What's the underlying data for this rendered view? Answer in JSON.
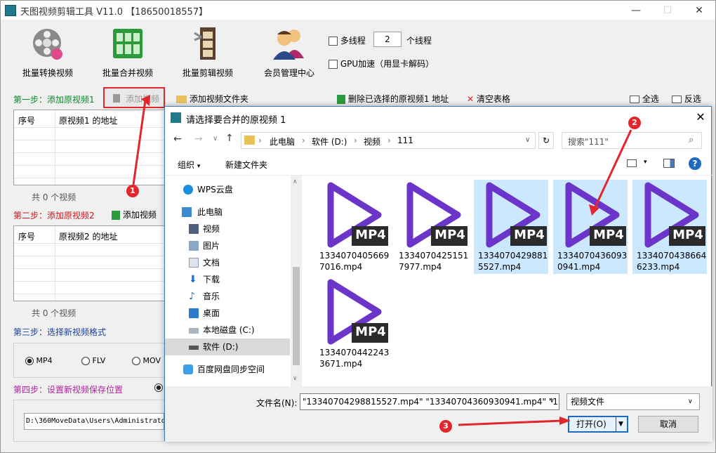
{
  "window": {
    "title": "天图视频剪辑工具 V11.0 【18650018557】"
  },
  "toolbar": [
    {
      "label": "批量转换视频"
    },
    {
      "label": "批量合并视频"
    },
    {
      "label": "批量剪辑视频"
    },
    {
      "label": "会员管理中心"
    }
  ],
  "options": {
    "multithread_label": "多线程",
    "threads_value": "2",
    "threads_unit": "个线程",
    "gpu_label": "GPU加速（用显卡解码）"
  },
  "step1": {
    "label": "第一步：添加原视频1",
    "add_video": "添加视频",
    "add_folder": "添加视频文件夹",
    "delete_selected": "删除已选择的原视频1 地址",
    "clear_table": "清空表格",
    "select_all": "全选",
    "invert": "反选",
    "col_index": "序号",
    "col_path": "原视频1 的地址",
    "count": "共 0 个视频"
  },
  "step2": {
    "label": "第二步：添加原视频2",
    "add_video": "添加视频",
    "col_index": "序号",
    "col_path": "原视频2 的地址",
    "count": "共 0 个视频"
  },
  "step3": {
    "label": "第三步：选择新视频格式",
    "formats": [
      "MP4",
      "FLV",
      "MOV"
    ]
  },
  "step4": {
    "label": "第四步：设置新视频保存位置",
    "path": "D:\\360MoveData\\Users\\Administrato"
  },
  "dialog": {
    "title": "请选择要合并的原视频 1",
    "breadcrumb": [
      "此电脑",
      "软件 (D:)",
      "视频",
      "111"
    ],
    "search_placeholder": "搜索\"111\"",
    "organize": "组织",
    "new_folder": "新建文件夹",
    "nav": [
      {
        "label": "WPS云盘"
      },
      {
        "label": "此电脑"
      },
      {
        "label": "视频"
      },
      {
        "label": "图片"
      },
      {
        "label": "文档"
      },
      {
        "label": "下载"
      },
      {
        "label": "音乐"
      },
      {
        "label": "桌面"
      },
      {
        "label": "本地磁盘 (C:)"
      },
      {
        "label": "软件 (D:)"
      },
      {
        "label": "百度网盘同步空间"
      }
    ],
    "files": [
      {
        "name": "13340704056697016.mp4",
        "badge": "MP4",
        "selected": false
      },
      {
        "name": "13340704251517977.mp4",
        "badge": "MP4",
        "selected": false
      },
      {
        "name": "13340704298815527.mp4",
        "badge": "MP4",
        "selected": true
      },
      {
        "name": "13340704360930941.mp4",
        "badge": "MP4",
        "selected": true
      },
      {
        "name": "13340704386646233.mp4",
        "badge": "MP4",
        "selected": true
      },
      {
        "name": "13340704422433671.mp4",
        "badge": "MP4",
        "selected": false
      }
    ],
    "filename_label": "文件名(N):",
    "filename_value": "\"13340704298815527.mp4\" \"13340704360930941.mp4\" \"13:",
    "filetype": "视频文件",
    "open_label": "打开(O)",
    "cancel_label": "取消"
  },
  "callouts": [
    "1",
    "2",
    "3"
  ],
  "colors": {
    "accent": "#e3262b",
    "selection": "#cce8ff",
    "play_icon": "#6a35c8"
  }
}
